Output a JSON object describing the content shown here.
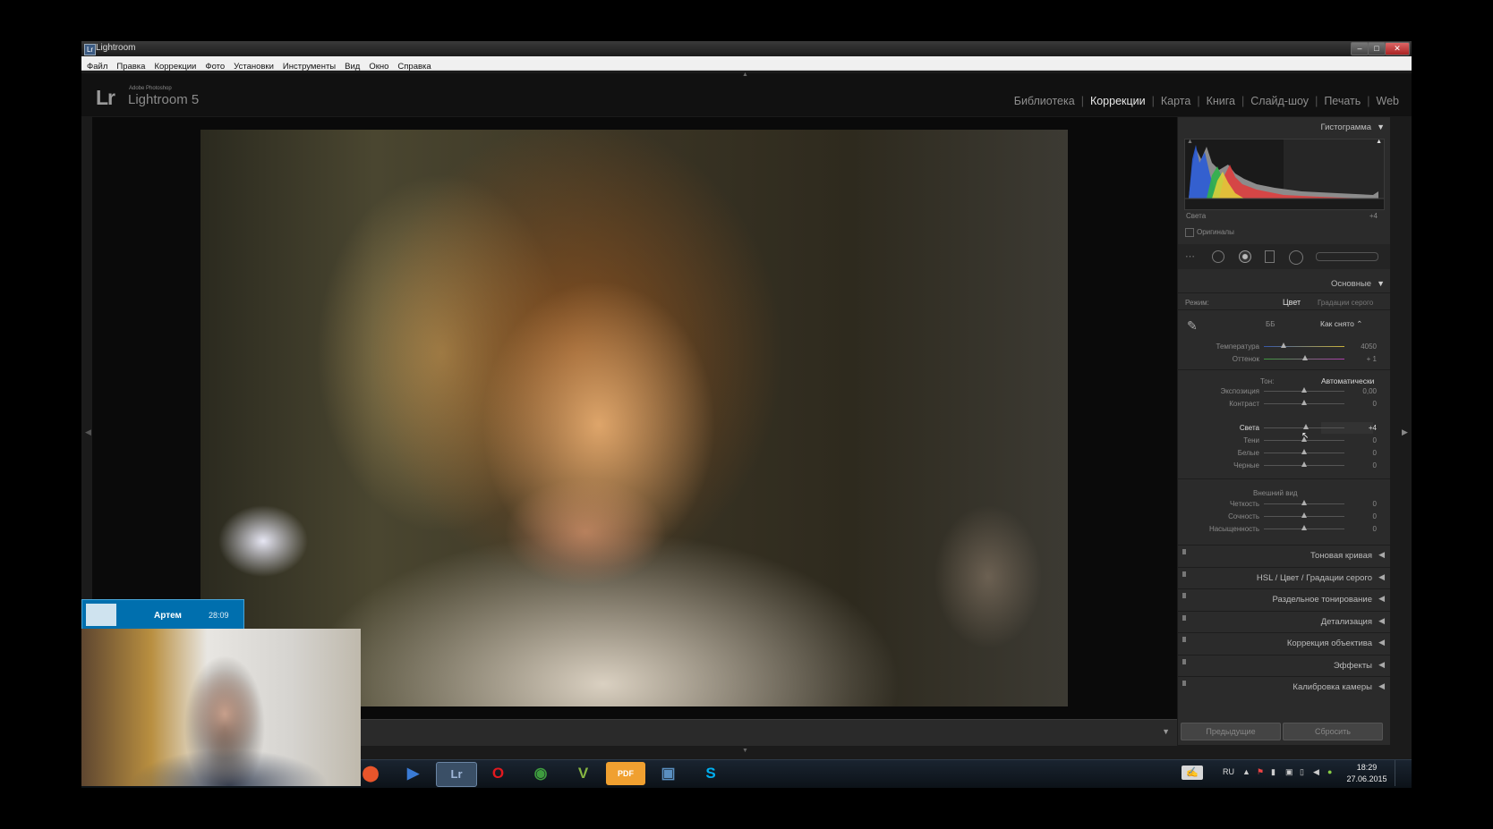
{
  "window": {
    "title": "Lightroom",
    "icon_letter": "Lr"
  },
  "menu": [
    "Файл",
    "Правка",
    "Коррекции",
    "Фото",
    "Установки",
    "Инструменты",
    "Вид",
    "Окно",
    "Справка"
  ],
  "identity": {
    "logo": "Lr",
    "brand_small": "Adobe Photoshop",
    "product": "Lightroom 5"
  },
  "modules": [
    {
      "label": "Библиотека",
      "active": false
    },
    {
      "label": "Коррекции",
      "active": true
    },
    {
      "label": "Карта",
      "active": false
    },
    {
      "label": "Книга",
      "active": false
    },
    {
      "label": "Слайд-шоу",
      "active": false
    },
    {
      "label": "Печать",
      "active": false
    },
    {
      "label": "Web",
      "active": false
    }
  ],
  "histogram": {
    "title": "Гистограмма",
    "readout_label": "Света",
    "readout_value": "+4",
    "originals_label": "Оригиналы"
  },
  "basic": {
    "title": "Основные",
    "mode_label": "Режим:",
    "mode_color": "Цвет",
    "mode_gray": "Градации серого",
    "wb_label": "ББ",
    "wb_value": "Как снято",
    "temp_label": "Температура",
    "temp_value": "4050",
    "tint_label": "Оттенок",
    "tint_value": "+ 1",
    "tone_label": "Тон:",
    "auto_label": "Автоматически",
    "sliders_tone": [
      {
        "label": "Экспозиция",
        "value": "0,00",
        "pos": 0.5
      },
      {
        "label": "Контраст",
        "value": "0",
        "pos": 0.5
      }
    ],
    "sliders_light": [
      {
        "label": "Света",
        "value": "+4",
        "pos": 0.52
      },
      {
        "label": "Тени",
        "value": "0",
        "pos": 0.5
      },
      {
        "label": "Белые",
        "value": "0",
        "pos": 0.5
      },
      {
        "label": "Черные",
        "value": "0",
        "pos": 0.5
      }
    ],
    "presence_label": "Внешний вид",
    "sliders_presence": [
      {
        "label": "Четкость",
        "value": "0",
        "pos": 0.5
      },
      {
        "label": "Сочность",
        "value": "0",
        "pos": 0.5
      },
      {
        "label": "Насыщенность",
        "value": "0",
        "pos": 0.5
      }
    ]
  },
  "panels": [
    {
      "label": "Тоновая кривая"
    },
    {
      "label": "HSL  /  Цвет  /  Градации серого"
    },
    {
      "label": "Раздельное тонирование"
    },
    {
      "label": "Детализация"
    },
    {
      "label": "Коррекция объектива"
    },
    {
      "label": "Эффекты"
    },
    {
      "label": "Калибровка камеры"
    }
  ],
  "buttons": {
    "previous": "Предыдущие",
    "reset": "Сбросить"
  },
  "skype": {
    "name": "Артем",
    "duration": "28:09"
  },
  "tray": {
    "lang": "RU",
    "time": "18:29",
    "date": "27.06.2015"
  },
  "taskbar_apps": [
    {
      "name": "chrome-alt",
      "glyph": "⬤",
      "color": "#e9552b"
    },
    {
      "name": "media-player",
      "glyph": "▶",
      "color": "#3a7bd5"
    },
    {
      "name": "lightroom",
      "glyph": "Lr",
      "color": "#9fb7d8"
    },
    {
      "name": "opera",
      "glyph": "O",
      "color": "#e3191f"
    },
    {
      "name": "chrome",
      "glyph": "◉",
      "color": "#3e9b3e"
    },
    {
      "name": "vectorworks",
      "glyph": "V",
      "color": "#86b542"
    },
    {
      "name": "pdf",
      "glyph": "PDF",
      "color": "#f0a030"
    },
    {
      "name": "network",
      "glyph": "▣",
      "color": "#5a8fc0"
    },
    {
      "name": "skype",
      "glyph": "S",
      "color": "#00aff0"
    }
  ]
}
